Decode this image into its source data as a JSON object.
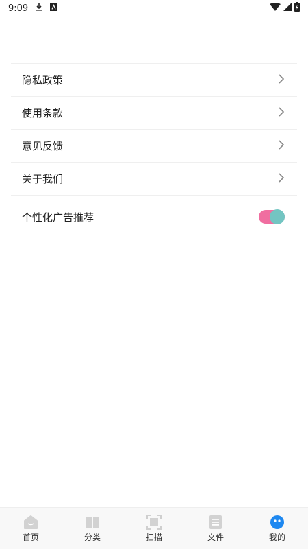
{
  "status_bar": {
    "time": "9:09",
    "icons": [
      "download-icon",
      "app-icon",
      "wifi-icon",
      "signal-icon",
      "battery-icon"
    ]
  },
  "menu": {
    "items": [
      {
        "label": "隐私政策",
        "icon": "chevron-right-icon"
      },
      {
        "label": "使用条款",
        "icon": "chevron-right-icon"
      },
      {
        "label": "意见反馈",
        "icon": "chevron-right-icon"
      },
      {
        "label": "关于我们",
        "icon": "chevron-right-icon"
      }
    ],
    "toggle_item": {
      "label": "个性化广告推荐",
      "enabled": true
    }
  },
  "bottom_nav": {
    "items": [
      {
        "label": "首页",
        "icon": "home-icon"
      },
      {
        "label": "分类",
        "icon": "book-icon"
      },
      {
        "label": "扫描",
        "icon": "scan-icon"
      },
      {
        "label": "文件",
        "icon": "file-icon"
      },
      {
        "label": "我的",
        "icon": "profile-icon",
        "active": true
      }
    ]
  },
  "colors": {
    "toggle_track": "#f06ea0",
    "toggle_knob": "#73c5c2",
    "active_tab": "#1e88f0",
    "inactive_icon": "#cfcfcf"
  }
}
